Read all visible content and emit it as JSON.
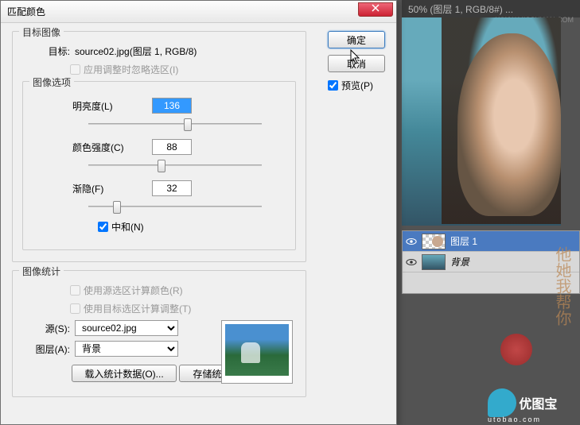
{
  "dialog": {
    "title": "匹配颜色",
    "target_group": {
      "legend": "目标图像",
      "target_label": "目标:",
      "target_value": "source02.jpg(图层 1, RGB/8)",
      "ignore_selection": "应用调整时忽略选区(I)"
    },
    "options_group": {
      "legend": "图像选项",
      "luminance_label": "明亮度(L)",
      "luminance_value": "136",
      "intensity_label": "颜色强度(C)",
      "intensity_value": "88",
      "fade_label": "渐隐(F)",
      "fade_value": "32",
      "neutralize": "中和(N)"
    },
    "stats_group": {
      "legend": "图像统计",
      "use_source_selection": "使用源选区计算颜色(R)",
      "use_target_selection": "使用目标选区计算调整(T)",
      "source_label": "源(S):",
      "source_value": "source02.jpg",
      "layer_label": "图层(A):",
      "layer_value": "背景",
      "load_stats": "载入统计数据(O)...",
      "save_stats": "存储统计数据(V)..."
    },
    "ok": "确定",
    "cancel": "取消",
    "preview": "预览(P)"
  },
  "document": {
    "tab": "50% (图层 1, RGB/8#) ..."
  },
  "layers": {
    "layer1": "图层 1",
    "background": "背景"
  },
  "watermark": {
    "text1": "他她我帮你",
    "logo_text": "优图宝",
    "logo_url": "utobao.com",
    "topright": "WWW.MISSYUAN.COM"
  }
}
